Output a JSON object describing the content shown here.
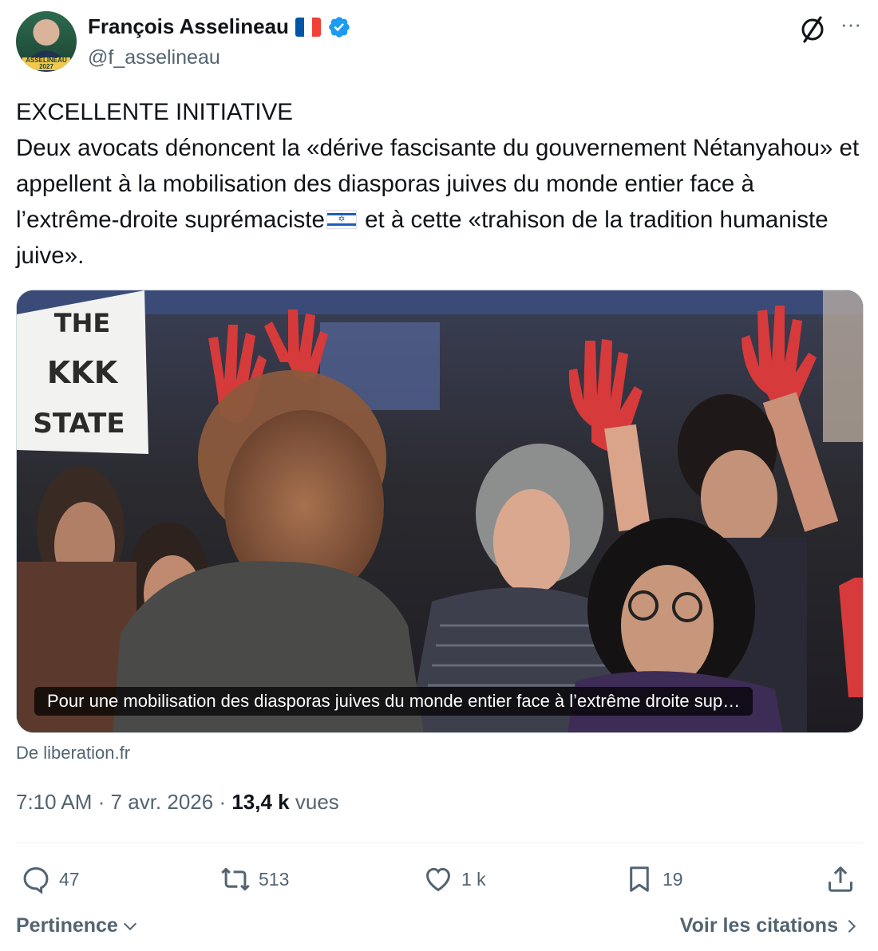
{
  "author": {
    "name": "François Asselineau",
    "handle": "@f_asselineau",
    "avatar_badge": "ASSELINEAU 2027",
    "flag_colors": [
      "#0055a4",
      "#ffffff",
      "#ef4135"
    ],
    "verified_color": "#1d9bf0"
  },
  "header_icons": {
    "grok": "grok-icon",
    "more": "···"
  },
  "tweet": {
    "text_before_flag": "EXCELLENTE INITIATIVE\nDeux avocats dénoncent la «dérive fascisante du gouvernement Nétanyahou» et appellent à la mobilisation des diasporas juives du monde entier face à l’extrême-droite suprémaciste",
    "text_after_flag": " et à cette «trahison de la tradition humaniste juive».",
    "inline_flag": "israel-flag-emoji"
  },
  "media": {
    "sign_lines": [
      "THE",
      "KKK",
      "STATE"
    ],
    "caption": "Pour une mobilisation des diasporas juives du monde entier face à l’extrême droite sup…",
    "source": "De liberation.fr"
  },
  "meta": {
    "time": "7:10 AM",
    "separator": "·",
    "date": "7 avr. 2026",
    "views_count": "13,4 k",
    "views_label": "vues"
  },
  "actions": {
    "replies": "47",
    "reposts": "513",
    "likes": "1 k",
    "bookmarks": "19"
  },
  "footer": {
    "sort_label": "Pertinence",
    "quotes_label": "Voir les citations"
  }
}
